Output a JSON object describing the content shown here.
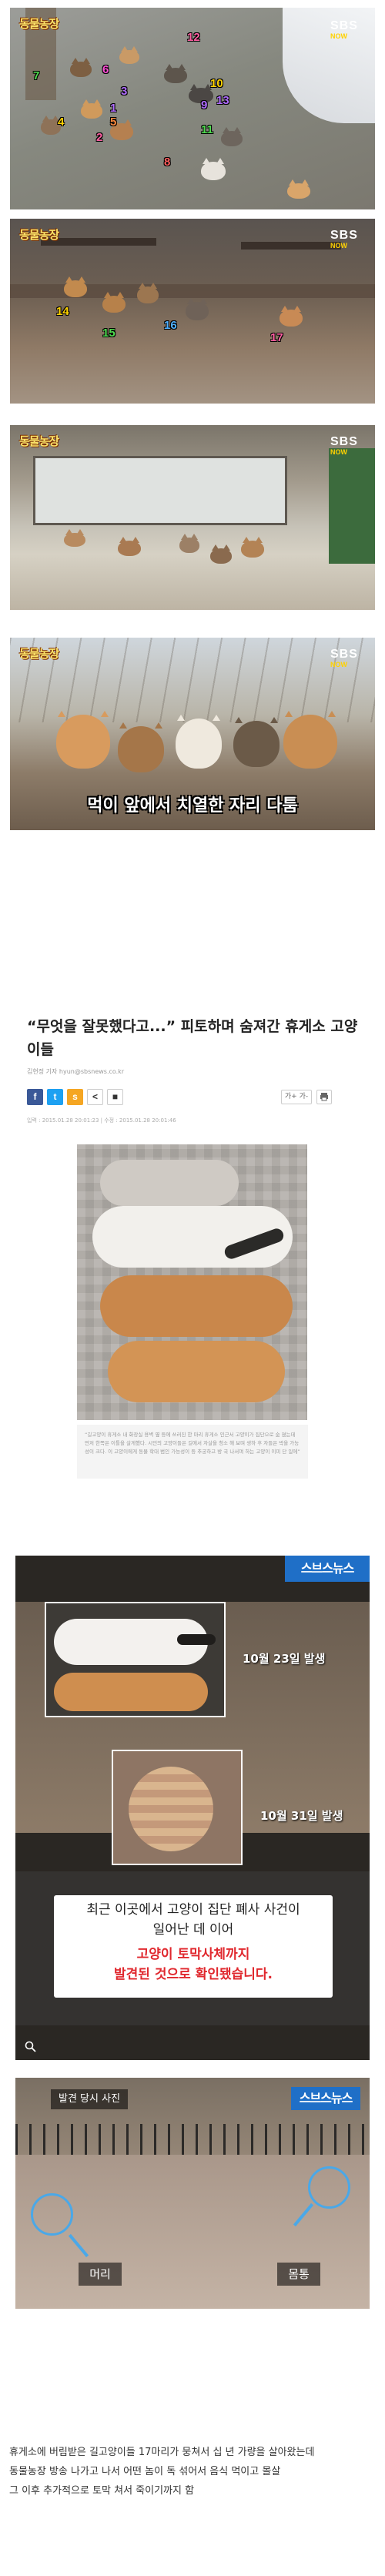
{
  "screenshots": {
    "brand_logo": "동물농장",
    "broadcaster": "SBS",
    "broadcaster_sub": "NOW",
    "scene1_numbers": [
      {
        "n": "1",
        "color": "#b06cff"
      },
      {
        "n": "2",
        "color": "#ff5fa2"
      },
      {
        "n": "3",
        "color": "#b06cff"
      },
      {
        "n": "4",
        "color": "#ffd200"
      },
      {
        "n": "5",
        "color": "#ff8a3d"
      },
      {
        "n": "6",
        "color": "#ff4fd8"
      },
      {
        "n": "7",
        "color": "#4fdc4f"
      },
      {
        "n": "8",
        "color": "#ff5f5f"
      },
      {
        "n": "9",
        "color": "#b06cff"
      },
      {
        "n": "10",
        "color": "#ffd200"
      },
      {
        "n": "11",
        "color": "#4fdc4f"
      },
      {
        "n": "12",
        "color": "#ff5fa2"
      },
      {
        "n": "13",
        "color": "#b06cff"
      }
    ],
    "scene2_numbers": [
      {
        "n": "14",
        "color": "#ffd200"
      },
      {
        "n": "15",
        "color": "#4fdc4f"
      },
      {
        "n": "16",
        "color": "#4fb0ff"
      },
      {
        "n": "17",
        "color": "#ff5fa2"
      }
    ],
    "scene4_subtitle": "먹이 앞에서 치열한 자리 다툼"
  },
  "article": {
    "headline": "“무엇을 잘못했다고...” 피토하며 숨져간 휴게소 고양이들",
    "byline": "김현정 기자 hyun@sbsnews.co.kr",
    "share_buttons": [
      {
        "icon": "facebook-icon",
        "glyph": "f",
        "color": "#3b5998"
      },
      {
        "icon": "twitter-icon",
        "glyph": "t",
        "color": "#1da1f2"
      },
      {
        "icon": "kakaostory-icon",
        "glyph": "s",
        "color": "#f5a623"
      },
      {
        "icon": "share-icon",
        "glyph": "<",
        "color": "#ffffff"
      },
      {
        "icon": "comment-icon",
        "glyph": "■",
        "color": "#ffffff"
      }
    ],
    "font_size_button": "가+ 가-",
    "print_icon": "print-icon",
    "dates": "입력 : 2015.01.28 20:01:23  |  수정 : 2015.01.28 20:01:46",
    "photo_caption": "“길고양이 휴게소 내 화장실 용벽 옆 등에 쓰러진 한 마리 휴게소 인근서 고양이가 집단으로 숨 졌는데 먼저 한쪽은 이틀을 살게했다. 시민의 고양이들은 길에서 자살을 청소 해 보며 생하 후 자들은 박을 가능성이 크다. 이 고양이에게 동물 학대 범인 가능성이 등 추궁하고 방 국 나서며 하는 고양이 이미 단 일에”"
  },
  "tv_news": {
    "logo": "스브스뉴스",
    "date1": "10월 23일 발생",
    "date2": "10월 31일 발생",
    "caption_line1": "최근 이곳에서 고양이 집단 폐사 사건이",
    "caption_line2": "일어난 데 이어",
    "caption_line3": "고양이 토막사체까지",
    "caption_line4": "발견된 것으로 확인됐습니다.",
    "scene_label": "발견 당시 사진",
    "logo2": "스브스뉴스",
    "label_head": "머리",
    "label_body": "몸통"
  },
  "body": {
    "paragraphs": [
      "휴게소에 버림받은 길고양이들 17마리가 뭉쳐서 십 년 가량을 살아왔는데",
      "동물농장 방송 나가고 나서 어떤 놈이 독 섞어서 음식 먹이고 몰살",
      "그 이후 추가적으로 토막 쳐서 죽이기까지 함"
    ]
  }
}
